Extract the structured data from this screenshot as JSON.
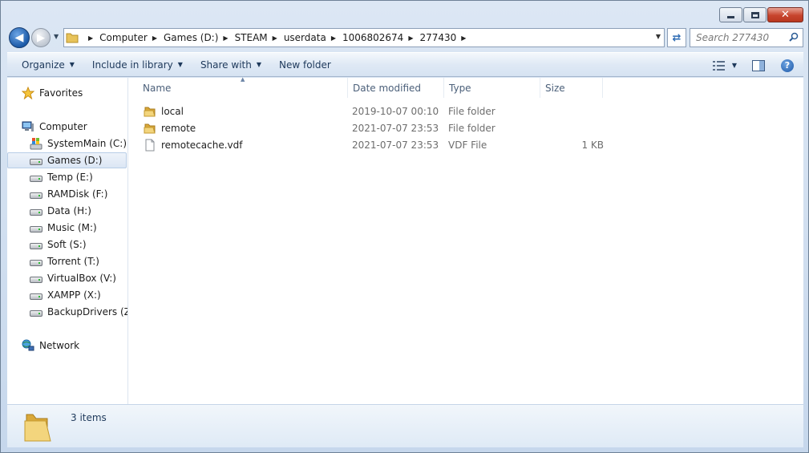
{
  "window": {
    "close_glyph": "✕"
  },
  "nav": {
    "back_glyph": "◀",
    "forward_glyph": "▶",
    "breadcrumbs": [
      "Computer",
      "Games (D:)",
      "STEAM",
      "userdata",
      "1006802674",
      "277430"
    ],
    "search_placeholder": "Search 277430"
  },
  "toolbar": {
    "organize": "Organize",
    "include_in_library": "Include in library",
    "share_with": "Share with",
    "new_folder": "New folder",
    "help_glyph": "?"
  },
  "sidebar": {
    "favorites": "Favorites",
    "computer": "Computer",
    "drives": [
      {
        "label": "SystemMain (C:)",
        "icon": "system-drive-icon"
      },
      {
        "label": "Games (D:)",
        "icon": "drive-icon",
        "selected": true
      },
      {
        "label": "Temp (E:)",
        "icon": "drive-icon"
      },
      {
        "label": "RAMDisk (F:)",
        "icon": "drive-icon"
      },
      {
        "label": "Data (H:)",
        "icon": "drive-icon"
      },
      {
        "label": "Music (M:)",
        "icon": "drive-icon"
      },
      {
        "label": "Soft (S:)",
        "icon": "drive-icon"
      },
      {
        "label": "Torrent (T:)",
        "icon": "drive-icon"
      },
      {
        "label": "VirtualBox (V:)",
        "icon": "drive-icon"
      },
      {
        "label": "XAMPP (X:)",
        "icon": "drive-icon"
      },
      {
        "label": "BackupDrivers (Z:)",
        "icon": "drive-icon"
      }
    ],
    "network": "Network"
  },
  "columns": {
    "name": "Name",
    "date_modified": "Date modified",
    "type": "Type",
    "size": "Size"
  },
  "files": [
    {
      "name": "local",
      "date": "2019-10-07 00:10",
      "type": "File folder",
      "size": "",
      "icon": "folder-icon"
    },
    {
      "name": "remote",
      "date": "2021-07-07 23:53",
      "type": "File folder",
      "size": "",
      "icon": "folder-icon"
    },
    {
      "name": "remotecache.vdf",
      "date": "2021-07-07 23:53",
      "type": "VDF File",
      "size": "1 KB",
      "icon": "file-icon"
    }
  ],
  "status": {
    "item_count": "3 items"
  },
  "colors": {
    "folder": "#e8c35a",
    "accent": "#1e395b",
    "selection": "#dbe6f4"
  }
}
